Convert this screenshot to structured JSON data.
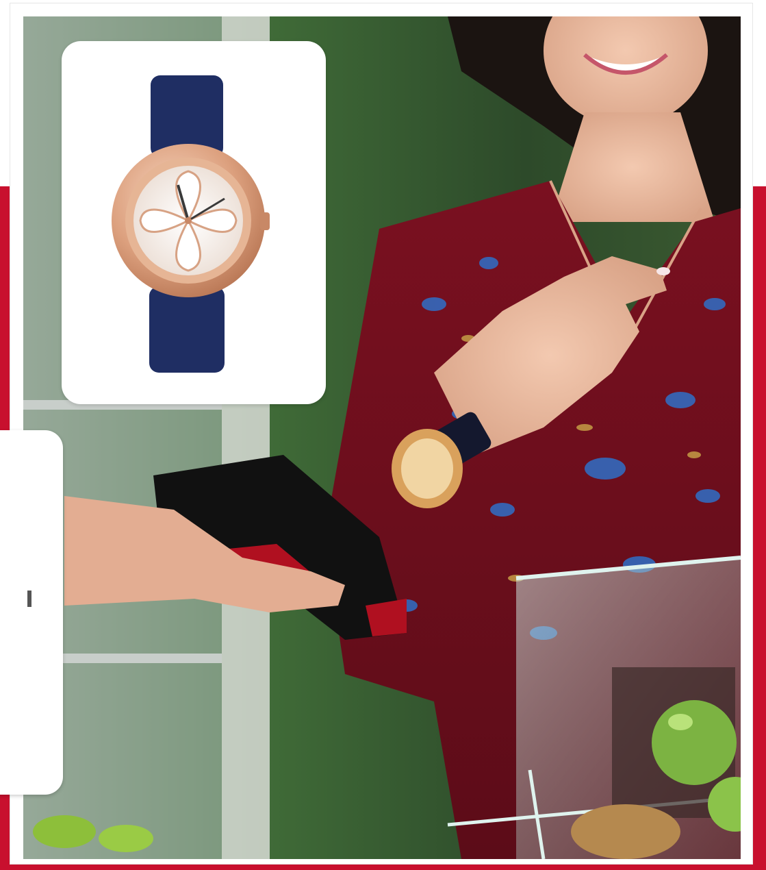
{
  "scene": {
    "accent_color": "#c8102e",
    "frame_color": "#ffffff"
  },
  "watch_card": {
    "icon": "wristwatch-icon",
    "strap_color": "#1f2e63",
    "case_color": "#d89a78"
  },
  "side_card": {
    "icon": "partial-card"
  }
}
